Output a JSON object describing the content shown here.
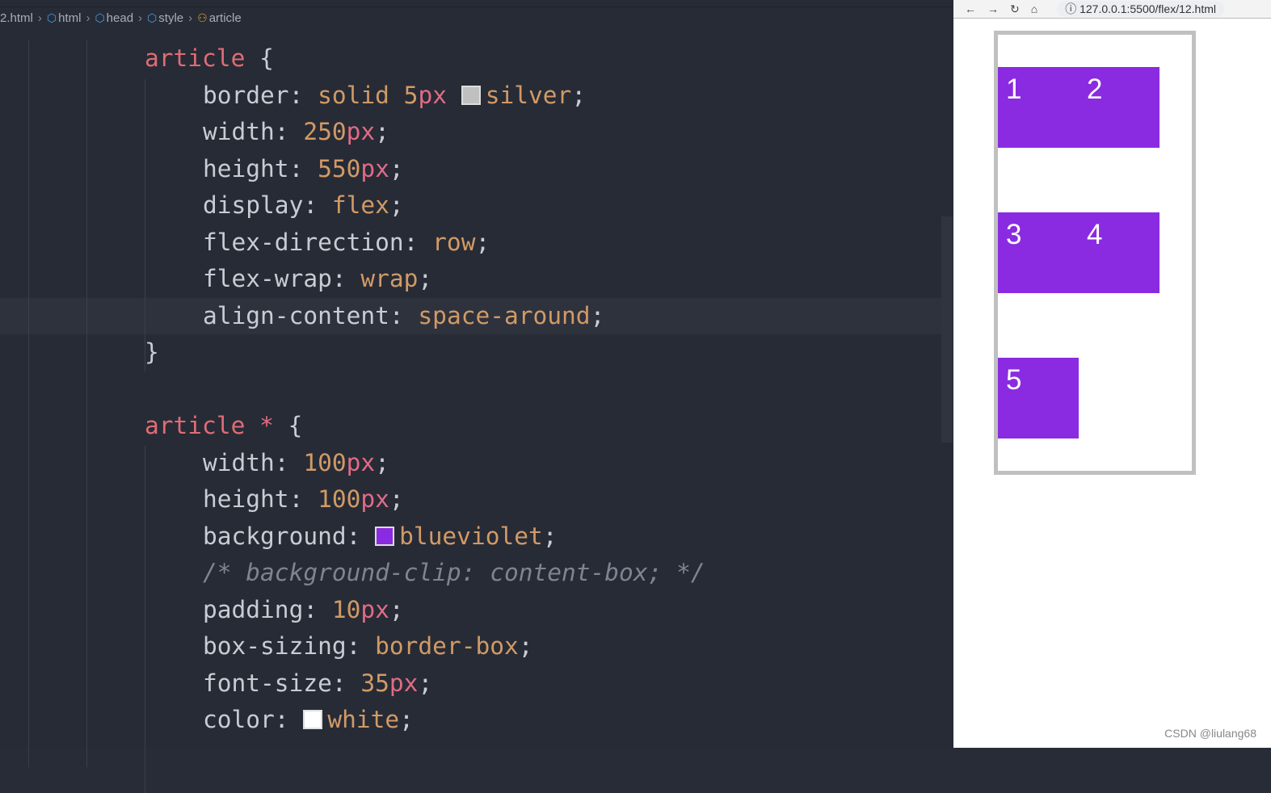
{
  "breadcrumb": [
    "2.html",
    "html",
    "head",
    "style",
    "article"
  ],
  "code": [
    [
      [
        "article ",
        "sel"
      ],
      [
        "{",
        "punc"
      ]
    ],
    [
      [
        "border: ",
        "prop"
      ],
      [
        "solid ",
        "val"
      ],
      [
        "5",
        "val"
      ],
      [
        "px ",
        "unit"
      ],
      [
        "#c0c0c0",
        "swatch"
      ],
      [
        "silver",
        "val"
      ],
      [
        ";",
        "punc"
      ]
    ],
    [
      [
        "width: ",
        "prop"
      ],
      [
        "250",
        "val"
      ],
      [
        "px",
        "unit"
      ],
      [
        ";",
        "punc"
      ]
    ],
    [
      [
        "height: ",
        "prop"
      ],
      [
        "550",
        "val"
      ],
      [
        "px",
        "unit"
      ],
      [
        ";",
        "punc"
      ]
    ],
    [
      [
        "display: ",
        "prop"
      ],
      [
        "flex",
        "val"
      ],
      [
        ";",
        "punc"
      ]
    ],
    [
      [
        "flex-direction: ",
        "prop"
      ],
      [
        "row",
        "val"
      ],
      [
        ";",
        "punc"
      ]
    ],
    [
      [
        "flex-wrap: ",
        "prop"
      ],
      [
        "wrap",
        "val"
      ],
      [
        ";",
        "punc"
      ]
    ],
    [
      [
        "align-content: ",
        "prop"
      ],
      [
        "space-around",
        "val"
      ],
      [
        ";",
        "punc"
      ]
    ],
    [
      [
        "}",
        "punc"
      ]
    ],
    [],
    [
      [
        "article ",
        "sel"
      ],
      [
        "* ",
        "unit"
      ],
      [
        "{",
        "punc"
      ]
    ],
    [
      [
        "width: ",
        "prop"
      ],
      [
        "100",
        "val"
      ],
      [
        "px",
        "unit"
      ],
      [
        ";",
        "punc"
      ]
    ],
    [
      [
        "height: ",
        "prop"
      ],
      [
        "100",
        "val"
      ],
      [
        "px",
        "unit"
      ],
      [
        ";",
        "punc"
      ]
    ],
    [
      [
        "background: ",
        "prop"
      ],
      [
        "#8a2be2",
        "swatch"
      ],
      [
        "blueviolet",
        "val"
      ],
      [
        ";",
        "punc"
      ]
    ],
    [
      [
        "/* background-clip: content-box; */",
        "cmt"
      ]
    ],
    [
      [
        "padding: ",
        "prop"
      ],
      [
        "10",
        "val"
      ],
      [
        "px",
        "unit"
      ],
      [
        ";",
        "punc"
      ]
    ],
    [
      [
        "box-sizing: ",
        "prop"
      ],
      [
        "border-box",
        "val"
      ],
      [
        ";",
        "punc"
      ]
    ],
    [
      [
        "font-size: ",
        "prop"
      ],
      [
        "35",
        "val"
      ],
      [
        "px",
        "unit"
      ],
      [
        ";",
        "punc"
      ]
    ],
    [
      [
        "color: ",
        "prop"
      ],
      [
        "#ffffff",
        "swatch"
      ],
      [
        "white",
        "val"
      ],
      [
        ";",
        "punc"
      ]
    ]
  ],
  "browser": {
    "url": "127.0.0.1:5500/flex/12.html",
    "items": [
      "1",
      "2",
      "3",
      "4",
      "5"
    ]
  },
  "watermark": "CSDN @liulang68"
}
